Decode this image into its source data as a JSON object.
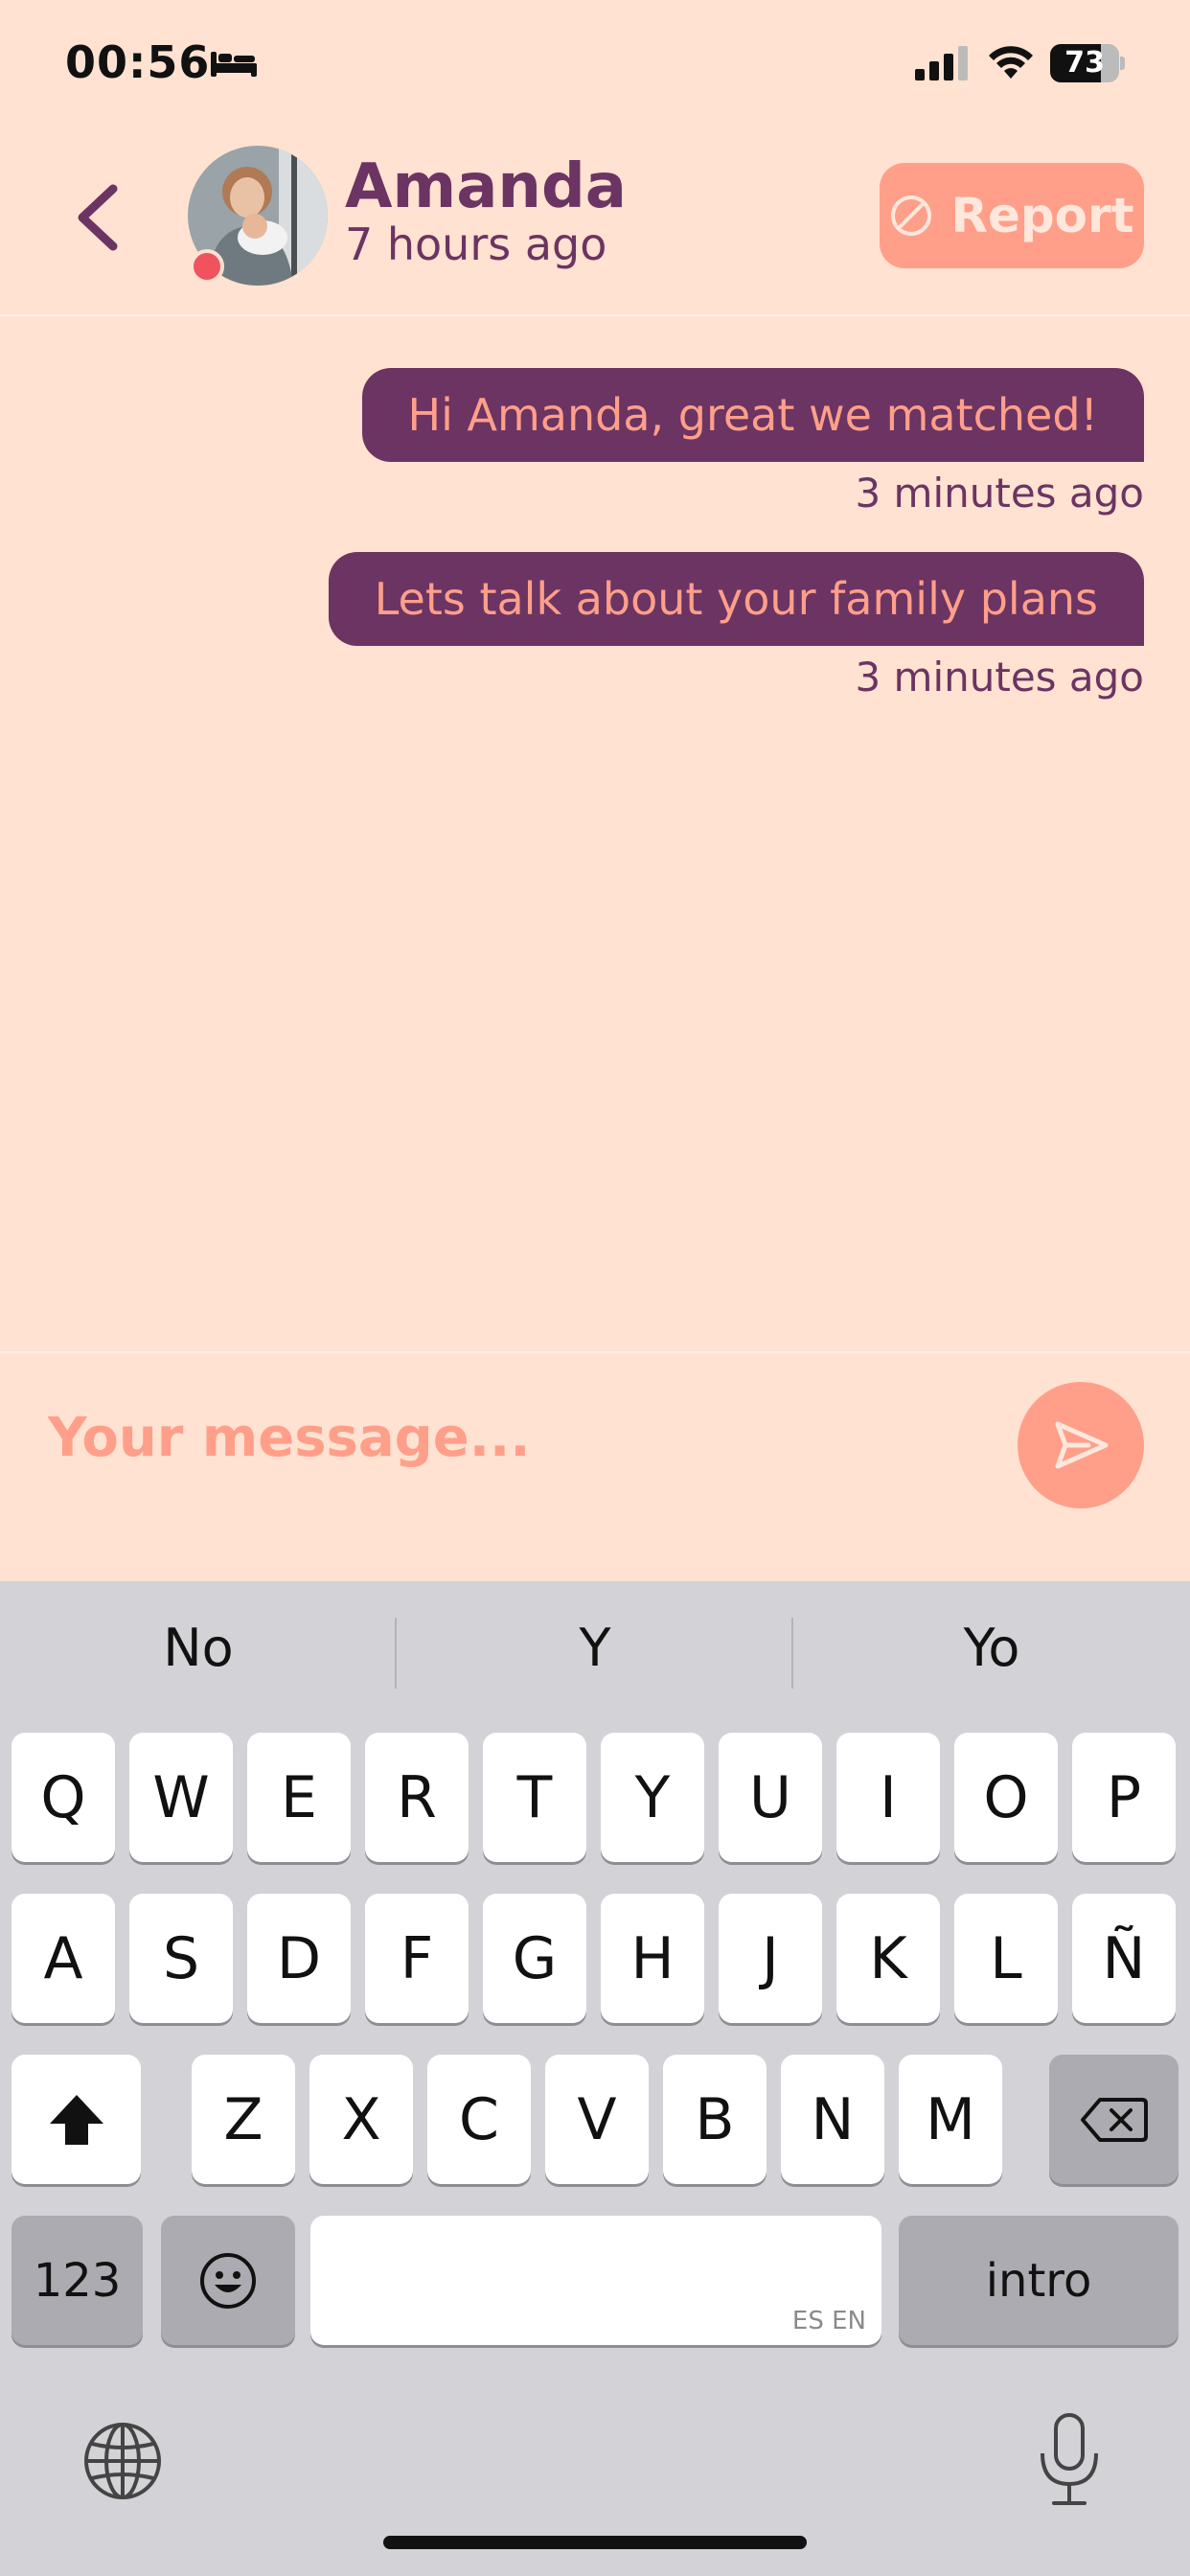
{
  "status_bar": {
    "time": "00:56",
    "sleep_icon": "bed-icon",
    "battery_level": "73",
    "battery_fraction": 0.73
  },
  "header": {
    "back_icon": "chevron-left-icon",
    "contact_name": "Amanda",
    "last_seen": "7 hours ago",
    "online_indicator_color": "#F0525E",
    "report_label": "Report",
    "report_icon": "block-icon"
  },
  "messages": [
    {
      "text": "Hi Amanda, great we matched!",
      "time": "3 minutes ago"
    },
    {
      "text": "Lets talk about your family plans",
      "time": "3 minutes ago"
    }
  ],
  "composer": {
    "placeholder": "Your message...",
    "send_icon": "send-icon"
  },
  "keyboard": {
    "suggestions": [
      "No",
      "Y",
      "Yo"
    ],
    "row1": [
      "Q",
      "W",
      "E",
      "R",
      "T",
      "Y",
      "U",
      "I",
      "O",
      "P"
    ],
    "row2": [
      "A",
      "S",
      "D",
      "F",
      "G",
      "H",
      "J",
      "K",
      "L",
      "Ñ"
    ],
    "row3": [
      "Z",
      "X",
      "C",
      "V",
      "B",
      "N",
      "M"
    ],
    "numbers_label": "123",
    "return_label": "intro",
    "space_languages": "ES EN"
  },
  "colors": {
    "background": "#FFE2D1",
    "primary": "#6B3462",
    "accent": "#FF9F8A"
  }
}
